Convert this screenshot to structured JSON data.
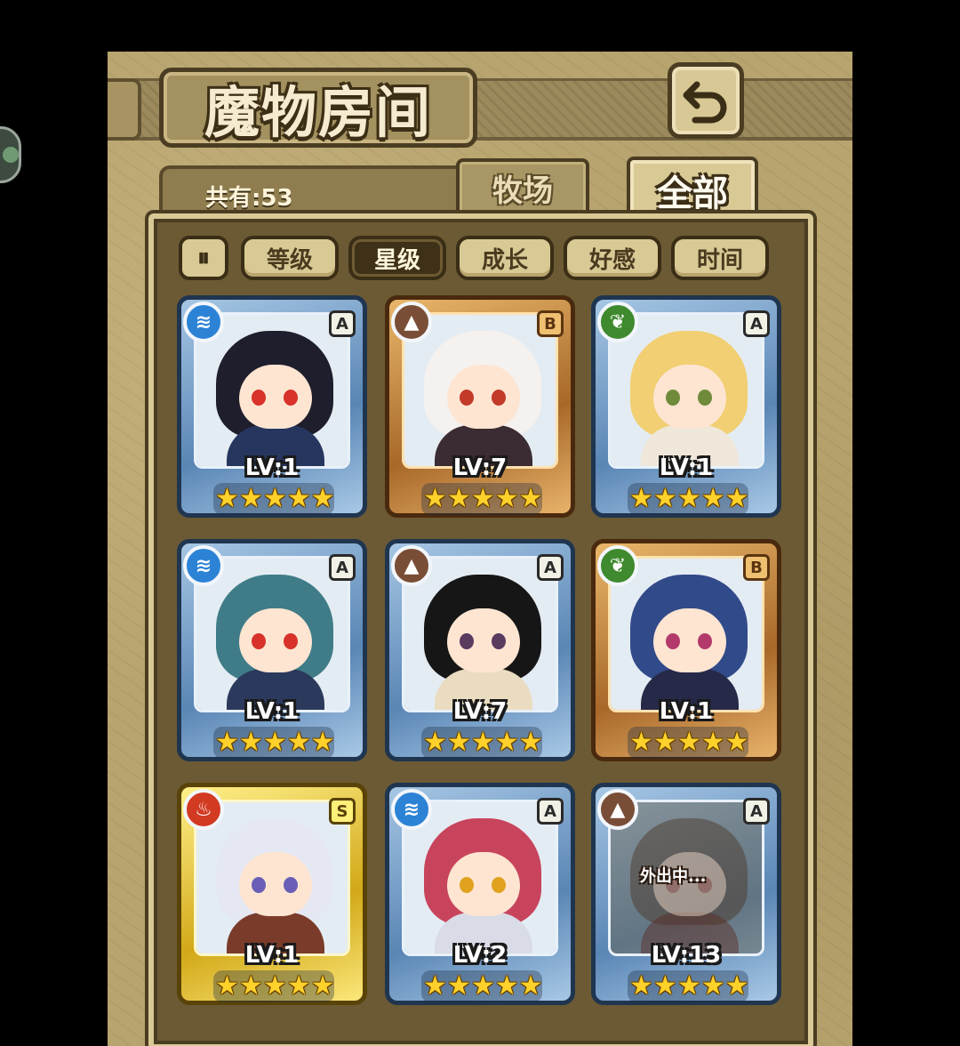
{
  "header": {
    "title": "魔物房间"
  },
  "count_label": "共有:53",
  "tabs": [
    {
      "label": "牧场",
      "active": false
    },
    {
      "label": "全部",
      "active": true
    }
  ],
  "sort_toggle_label": "⏸",
  "sort_buttons": [
    {
      "label": "等级",
      "active": false
    },
    {
      "label": "星级",
      "active": true
    },
    {
      "label": "成长",
      "active": false
    },
    {
      "label": "好感",
      "active": false
    },
    {
      "label": "时间",
      "active": false
    }
  ],
  "monsters": [
    {
      "element": "water",
      "element_icon": "water-icon",
      "rank": "A",
      "level": "LV:1",
      "stars": 5,
      "frame": "blue",
      "hair": "#1e1e2c",
      "eye": "#d8322a",
      "outfit": "#26365f",
      "away": false,
      "away_label": ""
    },
    {
      "element": "earth",
      "element_icon": "earth-icon",
      "rank": "B",
      "level": "LV:7",
      "stars": 5,
      "frame": "bronze",
      "hair": "#f4f1ee",
      "eye": "#c33a2a",
      "outfit": "#3b2b32",
      "away": false,
      "away_label": ""
    },
    {
      "element": "wood",
      "element_icon": "leaf-icon",
      "rank": "A",
      "level": "LV:1",
      "stars": 5,
      "frame": "blue",
      "hair": "#f1cf72",
      "eye": "#6f8a3a",
      "outfit": "#efe7da",
      "away": false,
      "away_label": ""
    },
    {
      "element": "water",
      "element_icon": "water-icon",
      "rank": "A",
      "level": "LV:1",
      "stars": 5,
      "frame": "blue",
      "hair": "#3f7c87",
      "eye": "#d8322a",
      "outfit": "#2b3a5c",
      "away": false,
      "away_label": ""
    },
    {
      "element": "earth",
      "element_icon": "earth-icon",
      "rank": "A",
      "level": "LV:7",
      "stars": 5,
      "frame": "blue",
      "hair": "#161616",
      "eye": "#5a3a5e",
      "outfit": "#e9dcc0",
      "away": false,
      "away_label": ""
    },
    {
      "element": "wood",
      "element_icon": "leaf-icon",
      "rank": "B",
      "level": "LV:1",
      "stars": 5,
      "frame": "bronze",
      "hair": "#314a8a",
      "eye": "#b23a6a",
      "outfit": "#262a48",
      "away": false,
      "away_label": ""
    },
    {
      "element": "fire",
      "element_icon": "fire-icon",
      "rank": "S",
      "level": "LV:1",
      "stars": 5,
      "frame": "gold",
      "hair": "#e5e8f3",
      "eye": "#6a5fb6",
      "outfit": "#7a3b2a",
      "away": false,
      "away_label": ""
    },
    {
      "element": "water",
      "element_icon": "water-icon",
      "rank": "A",
      "level": "LV:2",
      "stars": 5,
      "frame": "blue",
      "hair": "#c8445c",
      "eye": "#e0a21e",
      "outfit": "#d9dbe6",
      "away": false,
      "away_label": ""
    },
    {
      "element": "earth",
      "element_icon": "earth-icon",
      "rank": "A",
      "level": "LV:13",
      "stars": 5,
      "frame": "blue",
      "hair": "#4a3424",
      "eye": "#7a3a3a",
      "outfit": "#5a2a22",
      "away": true,
      "away_label": "外出中..."
    }
  ],
  "colors": {
    "water": "#2c83d6",
    "earth": "#7a4e36",
    "wood": "#3f8a2e",
    "fire": "#d23a22",
    "star": "#ffd12b",
    "frame_blue": "#5a86b5",
    "frame_bronze": "#a8682a",
    "frame_gold": "#d2a818"
  }
}
